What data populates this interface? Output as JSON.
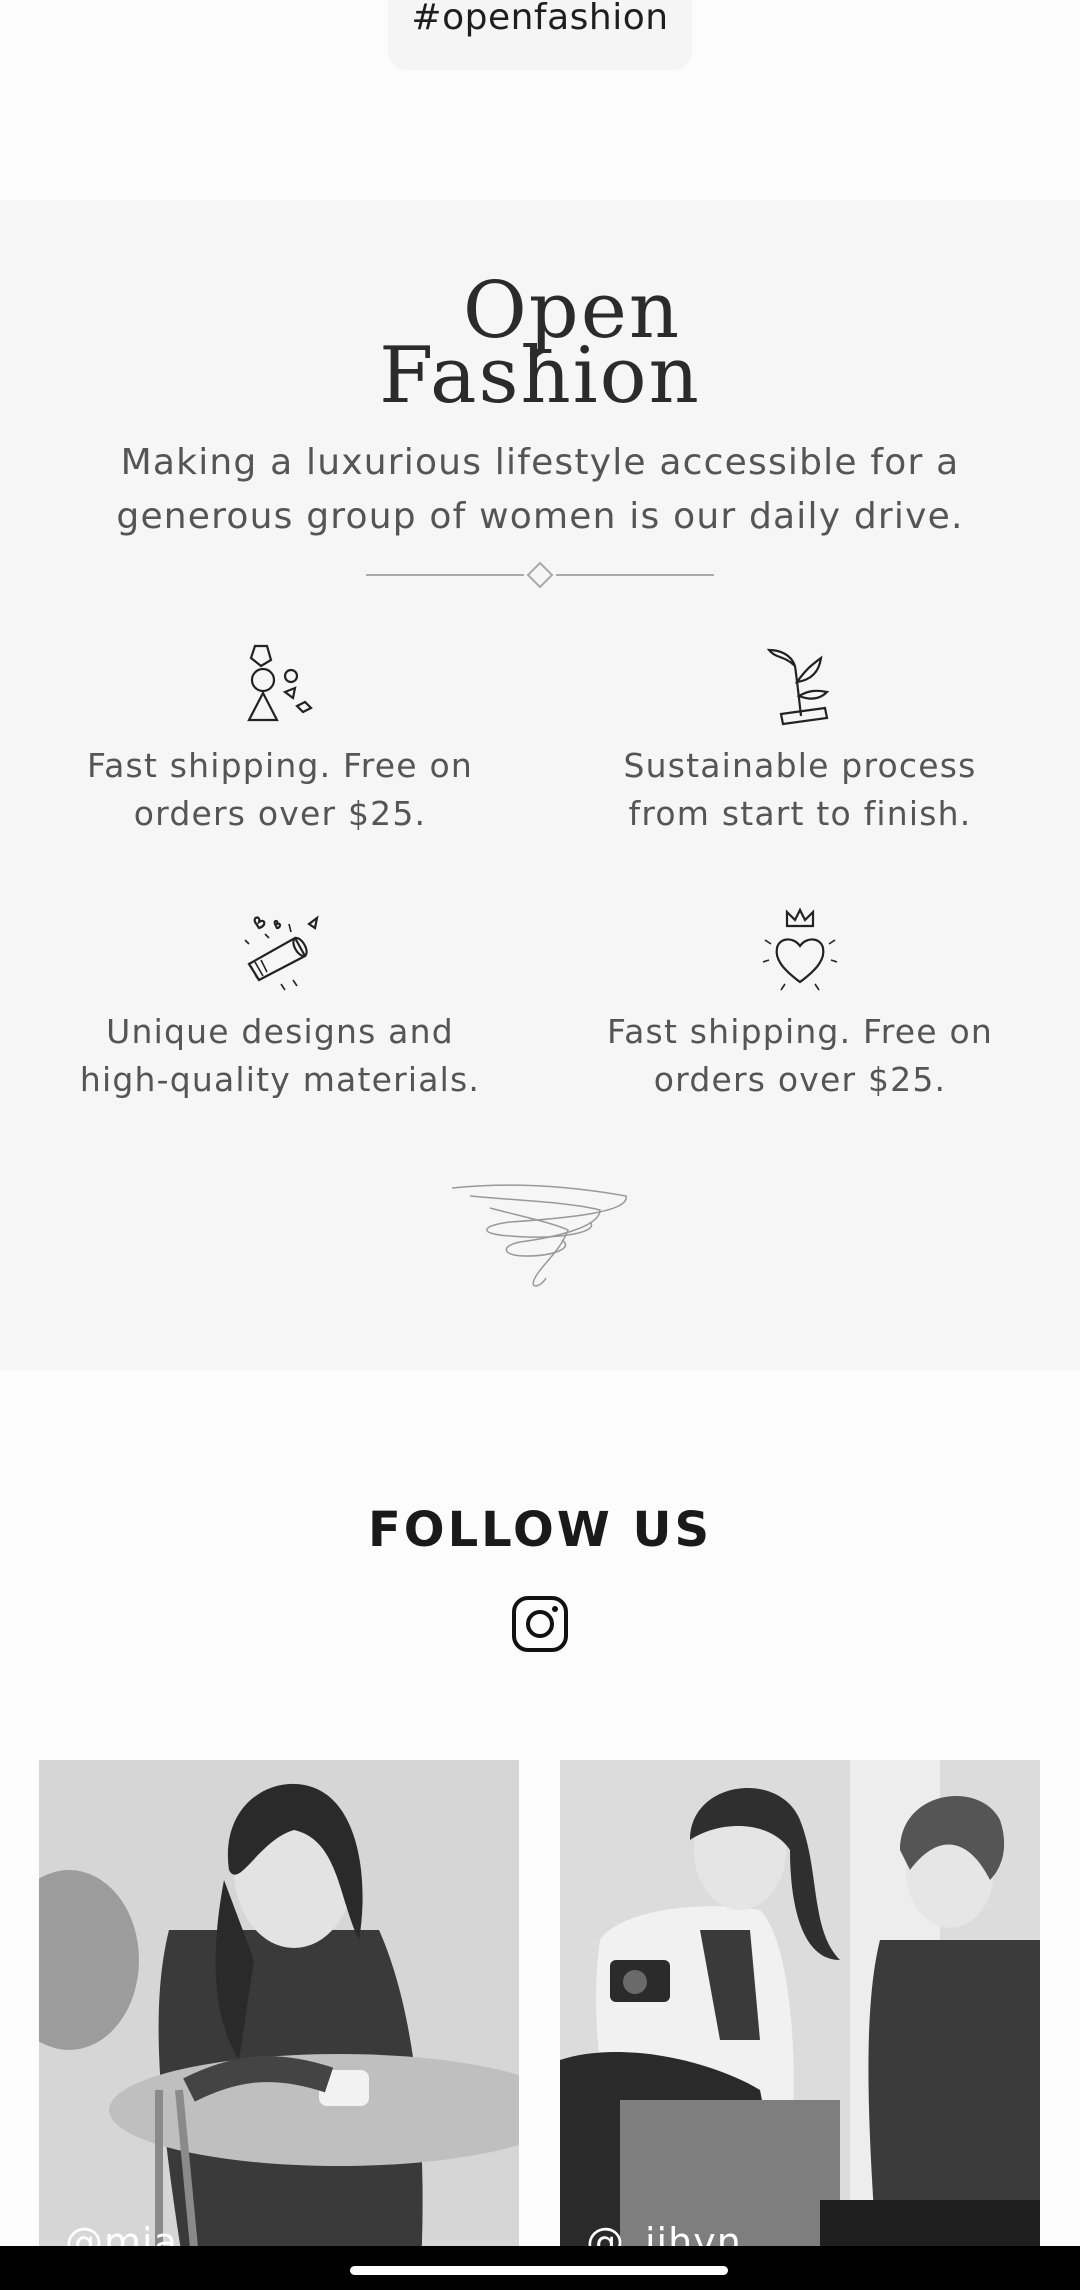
{
  "hashtag": "#openfashion",
  "about": {
    "logo_line1": "Open",
    "logo_line2": "Fashion",
    "tagline": "Making a luxurious lifestyle accessible for a generous group of women is our daily drive.",
    "features": [
      {
        "icon": "shapes-icon",
        "text": "Fast shipping. Free on orders over $25."
      },
      {
        "icon": "plant-icon",
        "text": "Sustainable process from start to finish."
      },
      {
        "icon": "confetti-popper-icon",
        "text": "Unique designs and high-quality materials."
      },
      {
        "icon": "crowned-heart-icon",
        "text": "Fast shipping. Free on orders over $25."
      }
    ]
  },
  "follow": {
    "title": "FOLLOW US",
    "icon": "instagram-icon",
    "posts": [
      {
        "handle": "@mia"
      },
      {
        "handle": "@_jihyn"
      }
    ]
  }
}
